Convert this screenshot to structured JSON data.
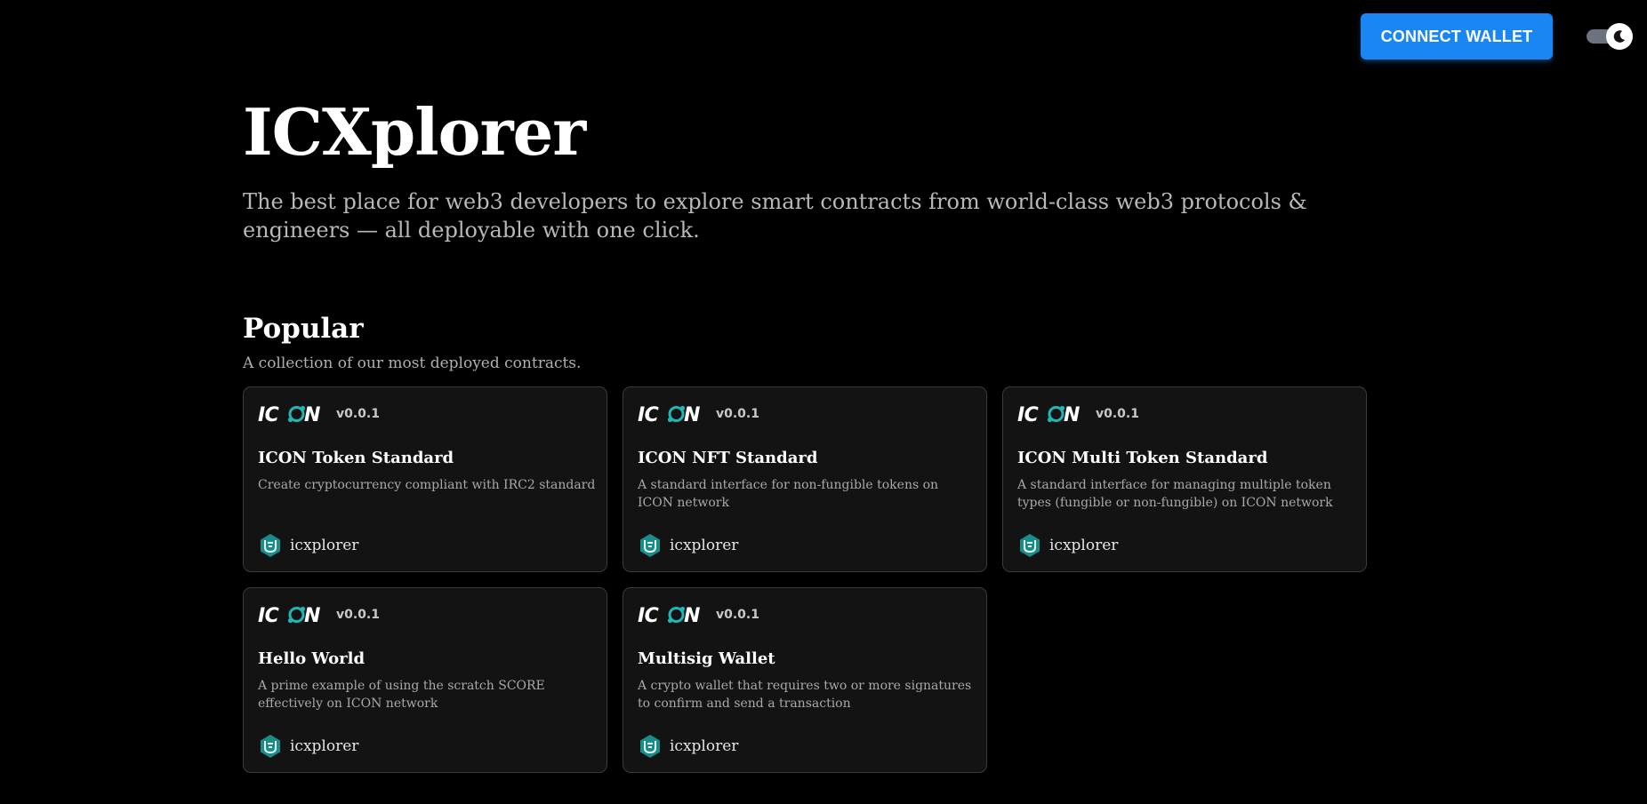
{
  "header": {
    "connect_label": "CONNECT WALLET",
    "theme_toggle_icon": "moon-icon"
  },
  "hero": {
    "title": "ICXplorer",
    "subtitle": "The best place for web3 developers to explore smart contracts from world-class web3 protocols & engineers — all deployable with one click."
  },
  "popular": {
    "title": "Popular",
    "subtitle": "A collection of our most deployed contracts.",
    "cards": [
      {
        "logo": "ICON",
        "version": "v0.0.1",
        "title": "ICON Token Standard",
        "description": "Create cryptocurrency compliant with IRC2 standard",
        "author": "icxplorer"
      },
      {
        "logo": "ICON",
        "version": "v0.0.1",
        "title": "ICON NFT Standard",
        "description": "A standard interface for non-fungible tokens on ICON network",
        "author": "icxplorer"
      },
      {
        "logo": "ICON",
        "version": "v0.0.1",
        "title": "ICON Multi Token Standard",
        "description": "A standard interface for managing multiple token types (fungible or non-fungible) on ICON network",
        "author": "icxplorer"
      },
      {
        "logo": "ICON",
        "version": "v0.0.1",
        "title": "Hello World",
        "description": "A prime example of using the scratch SCORE effectively on ICON network",
        "author": "icxplorer"
      },
      {
        "logo": "ICON",
        "version": "v0.0.1",
        "title": "Multisig Wallet",
        "description": "A crypto wallet that requires two or more signatures to confirm and send a transaction",
        "author": "icxplorer"
      }
    ]
  },
  "colors": {
    "background": "#000000",
    "accent": "#1a86f3",
    "card_bg": "#131313",
    "icon_teal": "#1fb6b5"
  }
}
